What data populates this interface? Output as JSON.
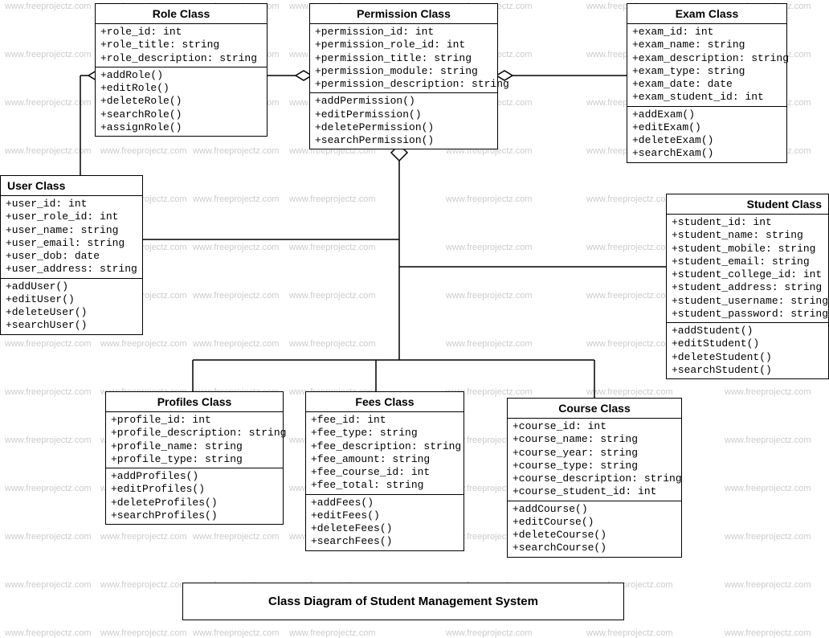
{
  "watermark": "www.freeprojectz.com",
  "diagram_title": "Class Diagram of Student Management System",
  "classes": {
    "role": {
      "name": "Role Class",
      "attrs": "+role_id: int\n+role_title: string\n+role_description: string",
      "ops": "+addRole()\n+editRole()\n+deleteRole()\n+searchRole()\n+assignRole()"
    },
    "permission": {
      "name": "Permission Class",
      "attrs": "+permission_id: int\n+permission_role_id: int\n+permission_title: string\n+permission_module: string\n+permission_description: string",
      "ops": "+addPermission()\n+editPermission()\n+deletePermission()\n+searchPermission()"
    },
    "exam": {
      "name": "Exam Class",
      "attrs": "+exam_id: int\n+exam_name: string\n+exam_description: string\n+exam_type: string\n+exam_date: date\n+exam_student_id: int",
      "ops": "+addExam()\n+editExam()\n+deleteExam()\n+searchExam()"
    },
    "user": {
      "name": "User Class",
      "attrs": "+user_id: int\n+user_role_id: int\n+user_name: string\n+user_email: string\n+user_dob: date\n+user_address: string",
      "ops": "+addUser()\n+editUser()\n+deleteUser()\n+searchUser()"
    },
    "student": {
      "name": "Student Class",
      "attrs": "+student_id: int\n+student_name: string\n+student_mobile: string\n+student_email: string\n+student_college_id: int\n+student_address: string\n+student_username: string\n+student_password: string",
      "ops": "+addStudent()\n+editStudent()\n+deleteStudent()\n+searchStudent()"
    },
    "profiles": {
      "name": "Profiles Class",
      "attrs": "+profile_id: int\n+profile_description: string\n+profile_name: string\n+profile_type: string",
      "ops": "+addProfiles()\n+editProfiles()\n+deleteProfiles()\n+searchProfiles()"
    },
    "fees": {
      "name": "Fees Class",
      "attrs": "+fee_id: int\n+fee_type: string\n+fee_description: string\n+fee_amount: string\n+fee_course_id: int\n+fee_total: string",
      "ops": "+addFees()\n+editFees()\n+deleteFees()\n+searchFees()"
    },
    "course": {
      "name": "Course Class",
      "attrs": "+course_id: int\n+course_name: string\n+course_year: string\n+course_type: string\n+course_description: string\n+course_student_id: int",
      "ops": "+addCourse()\n+editCourse()\n+deleteCourse()\n+searchCourse()"
    }
  }
}
